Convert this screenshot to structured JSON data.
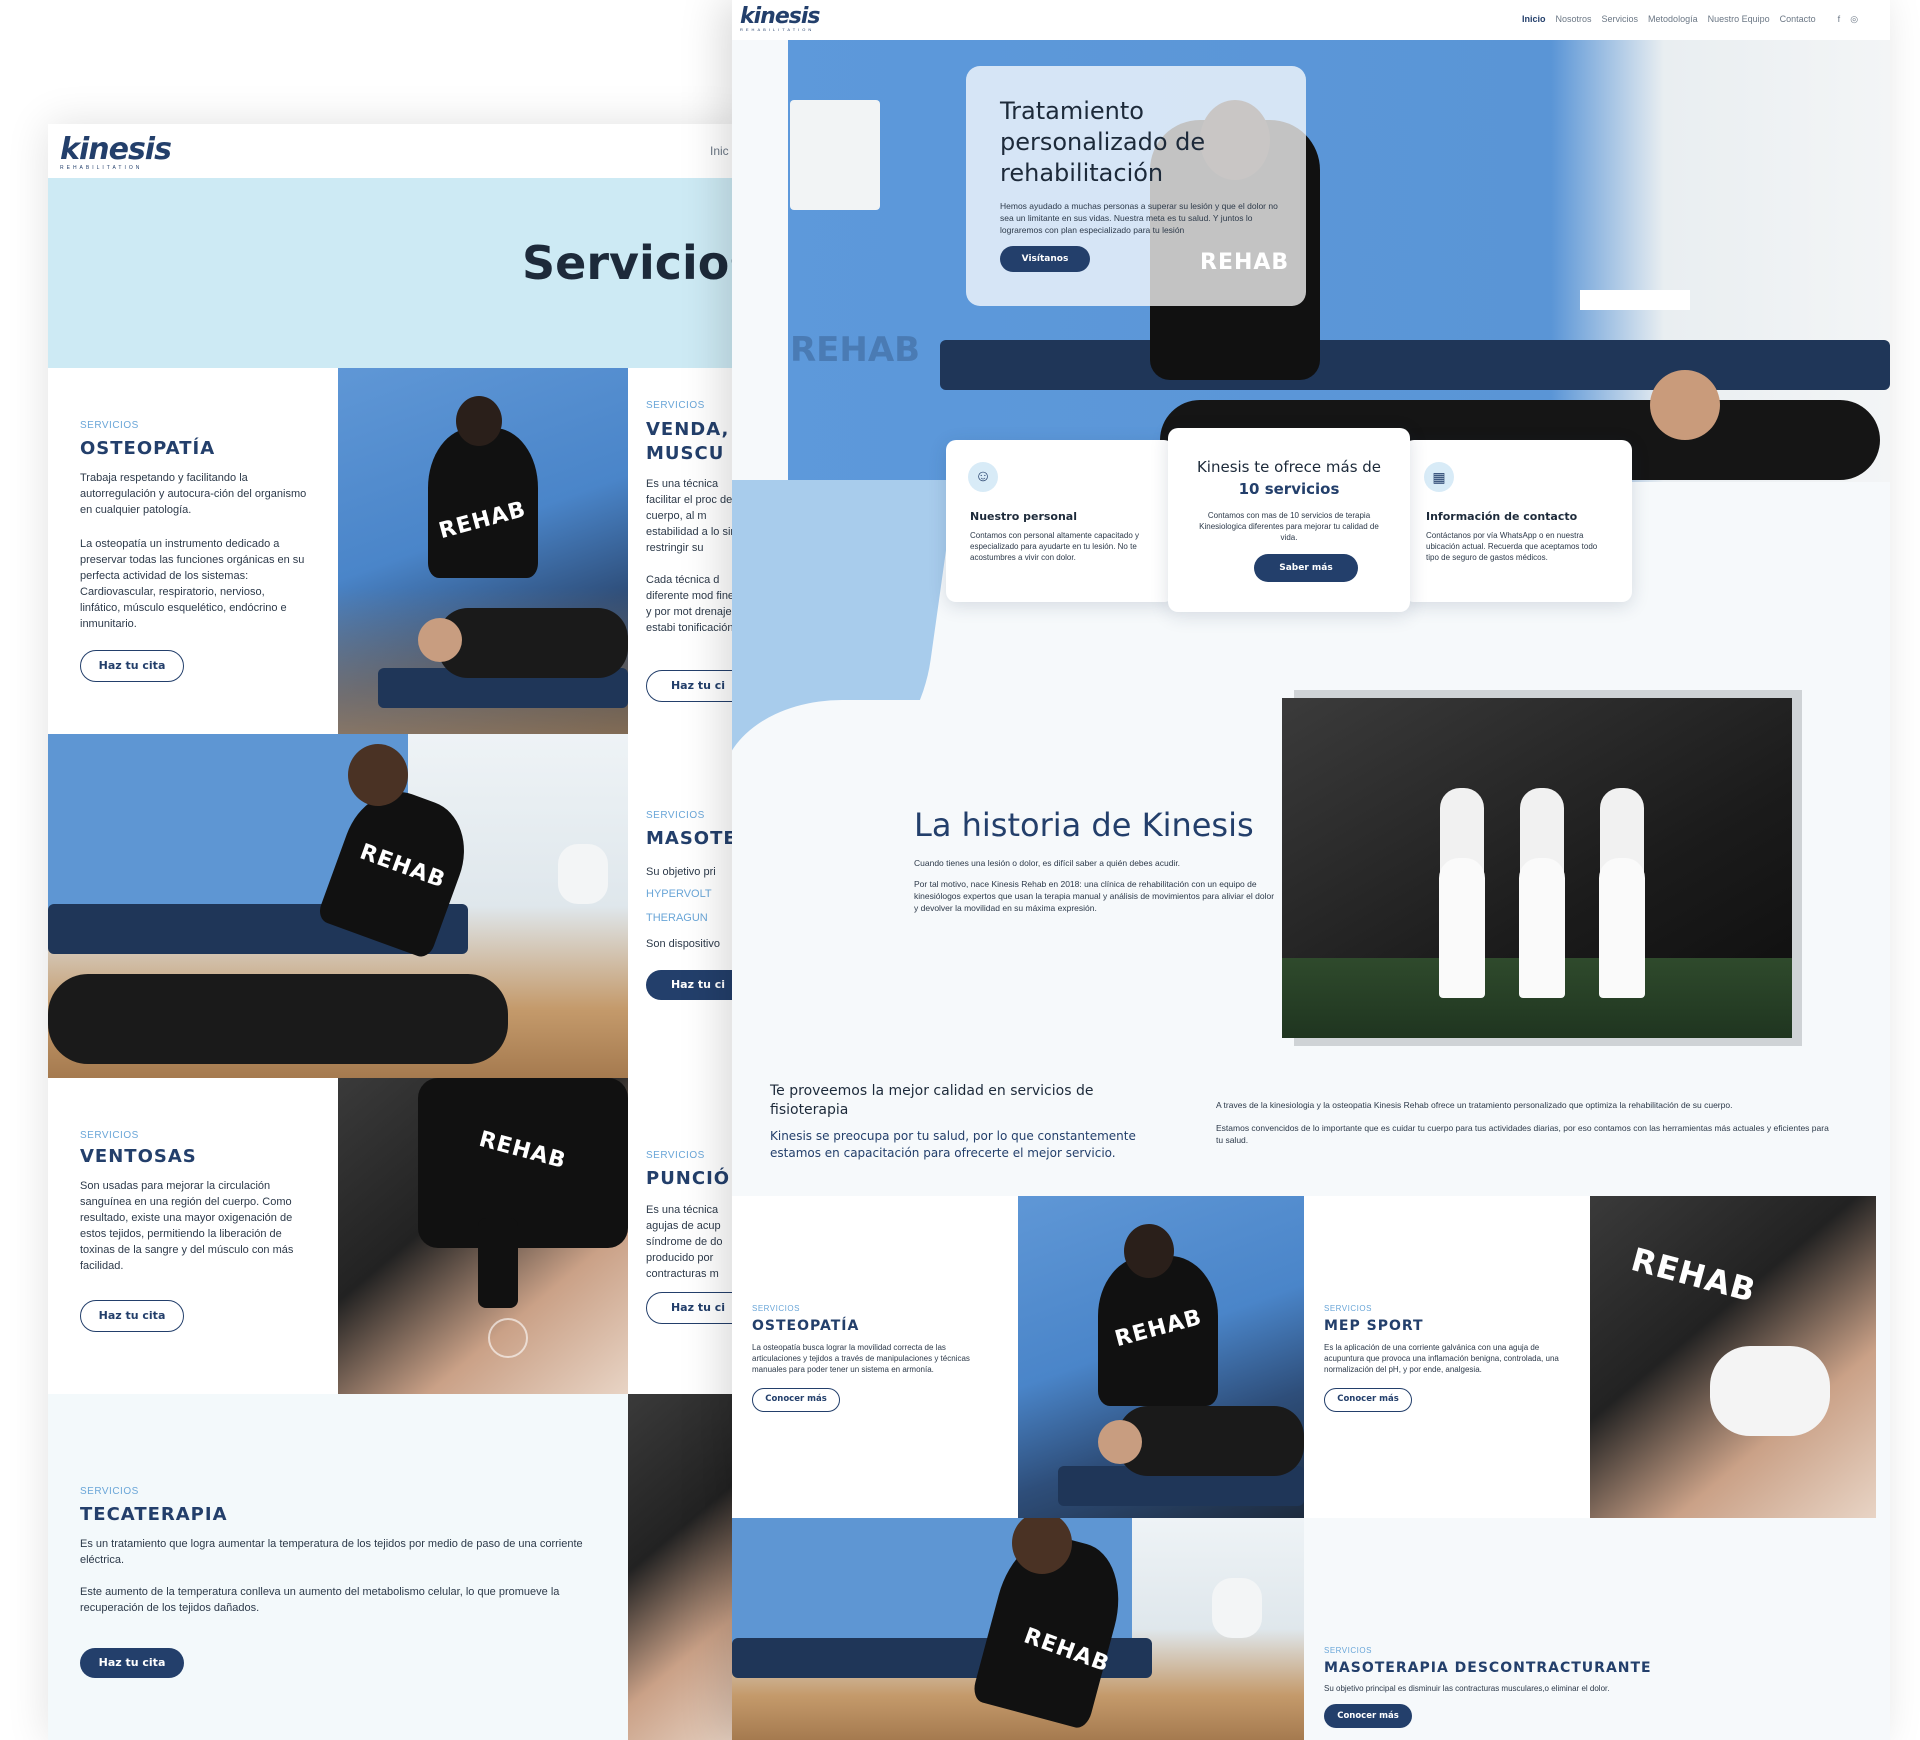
{
  "back_page": {
    "logo": "kinesis",
    "logo_sub": "REHABILITATION",
    "nav_partial": "Inic",
    "hero_title": "Servicios",
    "services": [
      {
        "label": "SERVICIOS",
        "title": "OSTEOPATÍA",
        "p1": "Trabaja respetando y facilitando la autorregulación y autocura-ción del organismo en cualquier patología.",
        "p2": "La osteopatía un instrumento dedicado a preservar todas las funciones orgánicas en su perfecta actividad de los sistemas: Cardiovascular, respiratorio, nervioso, linfático, músculo esquelético, endócrino e inmunitario.",
        "btn": "Haz tu cita"
      },
      {
        "label": "SERVICIOS",
        "title": "VENDA, MUSCU",
        "p1": "Es una técnica facilitar el proc del cuerpo, al m estabilidad a lo sin restringir su",
        "p2": "Cada técnica d diferente mod fines y por mot drenaje, estabi tonificación.",
        "btn": "Haz tu ci"
      },
      {
        "label": "SERVICIOS",
        "title": "MASOTE",
        "p1": "Su objetivo pri",
        "link1": "HYPERVOLT",
        "link2": "THERAGUN",
        "p2": "Son dispositivo",
        "btn": "Haz tu ci"
      },
      {
        "label": "SERVICIOS",
        "title": "VENTOSAS",
        "p1": "Son usadas para mejorar la circulación sanguínea en una región del cuerpo. Como resultado, existe una mayor oxigenación de estos tejidos, permitiendo la liberación de toxinas de la sangre y del músculo con más facilidad.",
        "btn": "Haz tu cita"
      },
      {
        "label": "SERVICIOS",
        "title": "PUNCIÓ",
        "p1": "Es una técnica agujas de acup síndrome de do producido por contracturas m",
        "btn": "Haz tu ci"
      },
      {
        "label": "SERVICIOS",
        "title": "TECATERAPIA",
        "p1": "Es un tratamiento que logra aumentar la temperatura de los tejidos por medio de paso de una corriente eléctrica.",
        "p2": "Este aumento de la temperatura conlleva un aumento del metabolismo celular, lo que promueve la recuperación de los tejidos dañados.",
        "btn": "Haz tu cita"
      }
    ]
  },
  "front_page": {
    "logo": "kinesis",
    "logo_sub": "REHABILITATION",
    "nav": [
      "Inicio",
      "Nosotros",
      "Servicios",
      "Metodología",
      "Nuestro Equipo",
      "Contacto"
    ],
    "social": [
      "f",
      "◎"
    ],
    "hero": {
      "title": "Tratamiento personalizado de rehabilitación",
      "text": "Hemos ayudado a muchas personas a superar su lesión y que el dolor no sea un limitante en sus vidas. Nuestra meta es tu salud. Y juntos lo lograremos con plan especializado para tu lesión",
      "btn": "Visítanos"
    },
    "wall_text": "REHAB",
    "shirt_text": "REHAB",
    "cards": [
      {
        "title": "Nuestro personal",
        "text": "Contamos con personal altamente capacitado y especializado para ayudarte en tu lesión. No te acostumbres a vivir con dolor."
      },
      {
        "title": "Kinesis te ofrece más de",
        "title2": "10 servicios",
        "text": "Contamos con mas de 10 servicios de terapia Kinesiologica diferentes para mejorar tu calidad de vida.",
        "btn": "Saber más"
      },
      {
        "title": "Información de contacto",
        "text": "Contáctanos por vía WhatsApp o en nuestra ubicación actual. Recuerda que aceptamos todo tipo de seguro de gastos médicos."
      }
    ],
    "history": {
      "title": "La historia de Kinesis",
      "p1": "Cuando tienes una lesión o dolor, es difícil saber a quién debes acudir.",
      "p2": "Por tal motivo, nace Kinesis Rehab en 2018: una clínica de rehabilitación con un equipo de kinesiólogos expertos que usan la terapia manual y análisis de movimientos para aliviar el dolor y devolver la movilidad en su máxima expresión."
    },
    "quality": {
      "title": "Te proveemos la mejor calidad en servicios de fisioterapia",
      "subtitle": "Kinesis se preocupa por tu salud, por lo que constantemente estamos en capacitación para ofrecerte el mejor servicio.",
      "p1": "A traves de la kinesiologia y la osteopatia Kinesis Rehab ofrece un tratamiento personalizado que optimiza la rehabilitación de su cuerpo.",
      "p2": "Estamos convencidos de lo importante que es cuidar tu cuerpo para tus actividades diarias, por eso contamos con las herramientas más actuales y eficientes para tu salud."
    },
    "services": [
      {
        "label": "SERVICIOS",
        "title": "OSTEOPATÍA",
        "text": "La osteopatía busca lograr la movilidad correcta de las articulaciones y tejidos a través de manipulaciones y técnicas manuales para poder tener un sistema en armonía.",
        "btn": "Conocer más"
      },
      {
        "label": "SERVICIOS",
        "title": "MEP SPORT",
        "text": "Es la aplicación de una corriente galvánica con una aguja de acupuntura que provoca una inflamación benigna, controlada, una normalización del pH, y por ende, analgesia.",
        "btn": "Conocer más"
      },
      {
        "label": "SERVICIOS",
        "title": "MASOTERAPIA DESCONTRACTURANTE",
        "text": "Su objetivo principal es disminuir las contracturas musculares,o eliminar el dolor.",
        "btn": "Conocer más"
      }
    ]
  }
}
